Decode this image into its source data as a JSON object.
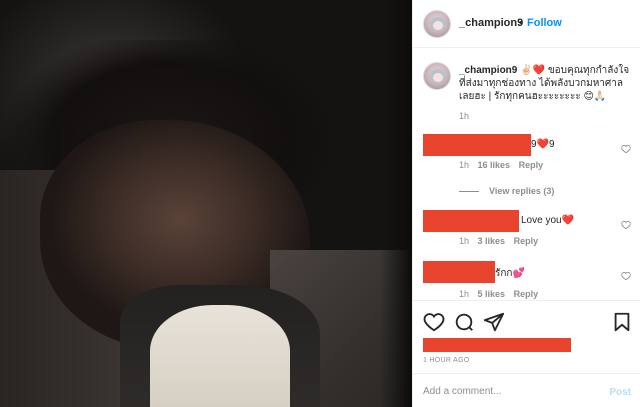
{
  "post": {
    "username": "_champion9",
    "separator": "•",
    "follow_label": "Follow"
  },
  "caption": {
    "username": "_champion9",
    "emojis_lead": "✌🏻❤️",
    "text": "ขอบคุณทุกกำลังใจที่ส่งมาทุกช่องทาง ได้พลังบวกมหาศาลเลยฮะ | รักทุกคนฮะะะะะะะะ",
    "emojis_tail": "😊🙏🏻",
    "time": "1h"
  },
  "comments": [
    {
      "visible_text": "9❤️9",
      "time": "1h",
      "likes": "16 likes",
      "reply": "Reply",
      "view_replies": "View replies (3)"
    },
    {
      "visible_text": "Love you❤️",
      "time": "1h",
      "likes": "3 likes",
      "reply": "Reply"
    },
    {
      "visible_text": "รักก💕",
      "time": "1h",
      "likes": "5 likes",
      "reply": "Reply"
    }
  ],
  "footer": {
    "time_ago": "1 HOUR AGO",
    "add_comment_placeholder": "Add a comment...",
    "post_label": "Post"
  },
  "colors": {
    "redaction": "#e8432d",
    "follow_blue": "#0095f6",
    "post_disabled": "#b2dffc",
    "muted_text": "#8e8e8e"
  },
  "icons": [
    "heart-icon",
    "comment-icon",
    "share-icon",
    "bookmark-icon"
  ]
}
